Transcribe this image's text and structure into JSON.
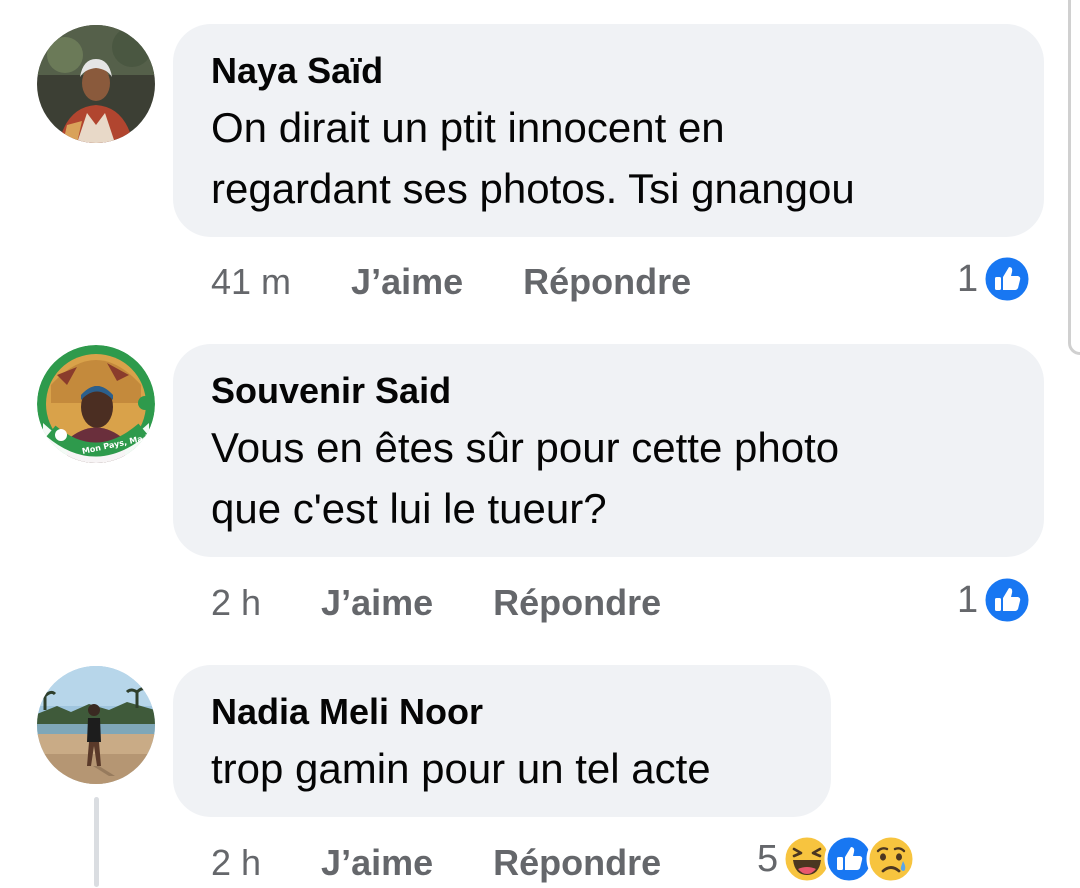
{
  "comments": [
    {
      "author": "Naya Saïd",
      "text_lines": [
        "On dirait un ptit innocent en",
        "regardant ses photos. Tsi gnangou"
      ],
      "time": "41 m",
      "like_label": "J’aime",
      "reply_label": "Répondre",
      "reaction_count": "1",
      "reactions": [
        "like-icon"
      ]
    },
    {
      "author": "Souvenir Said",
      "text_lines": [
        "Vous en êtes sûr pour cette photo",
        "que c'est lui le tueur?"
      ],
      "time": "2 h",
      "like_label": "J’aime",
      "reply_label": "Répondre",
      "reaction_count": "1",
      "reactions": [
        "like-icon"
      ],
      "avatar_badge": "Mon Pays, Ma Patrie"
    },
    {
      "author": "Nadia Meli Noor",
      "text_lines": [
        "trop gamin pour un tel acte"
      ],
      "time": "2 h",
      "like_label": "J’aime",
      "reply_label": "Répondre",
      "reaction_count": "5",
      "reactions": [
        "haha-icon",
        "like-icon",
        "sad-icon"
      ]
    }
  ],
  "colors": {
    "bubble": "#f0f2f5",
    "meta_text": "#65676b",
    "like_blue": "#1877f2",
    "haha_yellow": "#f7c43f"
  }
}
